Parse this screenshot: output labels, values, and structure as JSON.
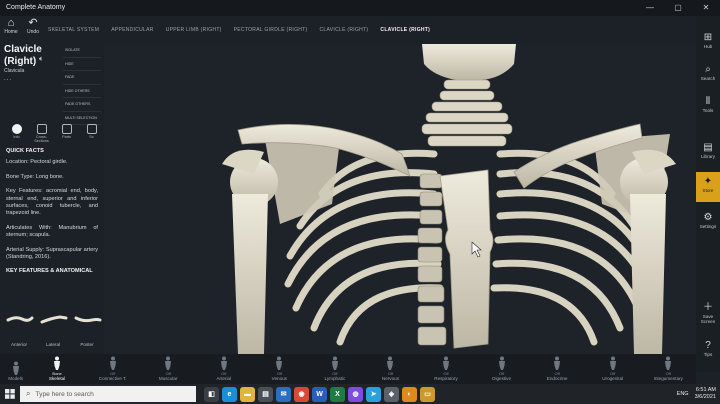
{
  "window": {
    "title": "Complete Anatomy",
    "controls": [
      "—",
      "▢",
      "✕"
    ]
  },
  "left_nav": {
    "home": "Home",
    "undo": "Undo"
  },
  "breadcrumbs": [
    {
      "label": "SKELETAL SYSTEM",
      "active": false
    },
    {
      "label": "APPENDICULAR",
      "active": false
    },
    {
      "label": "UPPER LIMB (RIGHT)",
      "active": false
    },
    {
      "label": "PECTORAL GIRDLE (RIGHT)",
      "active": false
    },
    {
      "label": "CLAVICLE (RIGHT)",
      "active": false
    },
    {
      "label": "CLAVICLE (RIGHT)",
      "active": true
    }
  ],
  "structure": {
    "name_line1": "Clavicle",
    "name_line2": "(Right)",
    "subtitle": "Clavicula",
    "more": "..."
  },
  "side_actions": [
    "ISOLATE",
    "HIDE",
    "FADE",
    "HIDE OTHERS",
    "FADE OTHERS",
    "MULTI SELECTION"
  ],
  "info_tabs": [
    {
      "label": "Info",
      "active": true
    },
    {
      "label": "Cross-Sections",
      "active": false
    },
    {
      "label": "Parts",
      "active": false
    },
    {
      "label": "Sc",
      "active": false
    }
  ],
  "facts": {
    "heading": "QUICK FACTS",
    "location": "Location: Pectoral girdle.",
    "bone_type": "Bone Type: Long bone.",
    "key_features": "Key Features: acromial end, body, sternal end, superior and inferior surfaces, conoid tubercle, and trapezoid line.",
    "articulates": "Articulates With: Manubrium of sternum; scapula.",
    "supply": "Arterial Supply: Suprascapular artery (Standring, 2016).",
    "section2": "KEY FEATURES & ANATOMICAL"
  },
  "views": [
    "Anterior",
    "Lateral",
    "Poster"
  ],
  "right_bar": [
    {
      "icon": "hub-icon",
      "glyph": "⊞",
      "label": "Hub"
    },
    {
      "icon": "search-icon",
      "glyph": "⌕",
      "label": "Search"
    },
    {
      "icon": "tools-icon",
      "glyph": "⫴",
      "label": "Tools"
    },
    {
      "icon": "library-icon",
      "glyph": "▤",
      "label": "Library"
    },
    {
      "icon": "store-icon",
      "glyph": "✦",
      "label": "Store"
    },
    {
      "icon": "settings-icon",
      "glyph": "⚙",
      "label": "Settings"
    },
    {
      "icon": "save-screen-icon",
      "glyph": "＋",
      "label": "Save Screen"
    },
    {
      "icon": "tips-icon",
      "glyph": "?",
      "label": "Tips"
    }
  ],
  "systems": [
    {
      "label": "Models",
      "state": "",
      "on": false
    },
    {
      "label": "Skeletal",
      "state": "Bone",
      "on": true
    },
    {
      "label": "Connective T.",
      "state": "Off",
      "on": false
    },
    {
      "label": "Muscular",
      "state": "Off",
      "on": false
    },
    {
      "label": "Arterial",
      "state": "Off",
      "on": false
    },
    {
      "label": "Venous",
      "state": "Off",
      "on": false
    },
    {
      "label": "Lymphatic",
      "state": "Off",
      "on": false
    },
    {
      "label": "Nervous",
      "state": "Off",
      "on": false
    },
    {
      "label": "Respiratory",
      "state": "Off",
      "on": false
    },
    {
      "label": "Digestive",
      "state": "Off",
      "on": false
    },
    {
      "label": "Endocrine",
      "state": "Off",
      "on": false
    },
    {
      "label": "Urogenital",
      "state": "Off",
      "on": false
    },
    {
      "label": "Integumentary",
      "state": "Off",
      "on": false
    }
  ],
  "taskbar": {
    "search_placeholder": "Type here to search",
    "apps": [
      {
        "name": "task-view",
        "color": "#3a3f45",
        "glyph": "◧"
      },
      {
        "name": "edge",
        "color": "#1a8fd6",
        "glyph": "e"
      },
      {
        "name": "file-explorer",
        "color": "#e4b43a",
        "glyph": "▬"
      },
      {
        "name": "store-app",
        "color": "#4a5058",
        "glyph": "▤"
      },
      {
        "name": "mail",
        "color": "#2a6fbf",
        "glyph": "✉"
      },
      {
        "name": "chrome",
        "color": "#d9493a",
        "glyph": "◉"
      },
      {
        "name": "word",
        "color": "#2b5eb8",
        "glyph": "W"
      },
      {
        "name": "excel",
        "color": "#1f7a45",
        "glyph": "X"
      },
      {
        "name": "messenger",
        "color": "#7b4ee0",
        "glyph": "◍"
      },
      {
        "name": "telegram",
        "color": "#2aa1da",
        "glyph": "➤"
      },
      {
        "name": "complete-anatomy",
        "color": "#5b6168",
        "glyph": "◈"
      },
      {
        "name": "app-orange",
        "color": "#e08a1c",
        "glyph": "◐"
      },
      {
        "name": "app-folder",
        "color": "#c99a2e",
        "glyph": "▭"
      }
    ],
    "language": "ENG",
    "time": "6:51 AM",
    "date": "3/6/2021"
  },
  "colors": {
    "bone": "#e6e1d2",
    "bone_shadow": "#b9b3a1",
    "accent_store": "#d9a019"
  }
}
